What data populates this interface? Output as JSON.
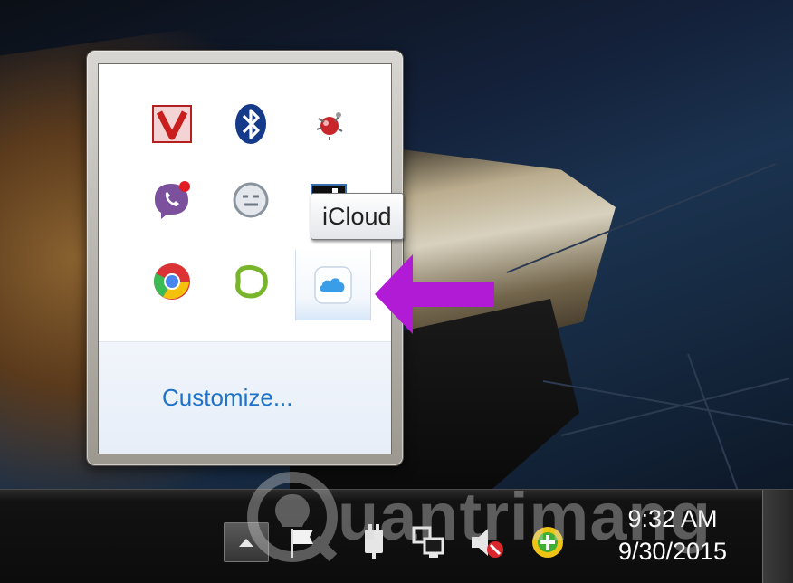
{
  "tooltip": {
    "text": "iCloud"
  },
  "popup": {
    "customize_label": "Customize...",
    "icons": [
      {
        "name": "vipre-antivirus-icon"
      },
      {
        "name": "bluetooth-icon"
      },
      {
        "name": "network-bug-icon"
      },
      {
        "name": "viber-icon"
      },
      {
        "name": "emoji-face-icon"
      },
      {
        "name": "black-square-app-icon"
      },
      {
        "name": "chrome-icon"
      },
      {
        "name": "green-lasso-icon"
      },
      {
        "name": "icloud-icon"
      }
    ]
  },
  "taskbar": {
    "clock": {
      "time": "9:32 AM",
      "date": "9/30/2015"
    },
    "tray_icons": [
      "flag-icon",
      "power-plug-icon",
      "network-monitor-icon",
      "speaker-muted-icon",
      "update-shield-icon"
    ]
  },
  "watermark": {
    "text": "uantrimang"
  },
  "colors": {
    "accent_link": "#1e73c9",
    "arrow": "#b21bd6",
    "taskbar_bg": "#0c0c0c"
  }
}
